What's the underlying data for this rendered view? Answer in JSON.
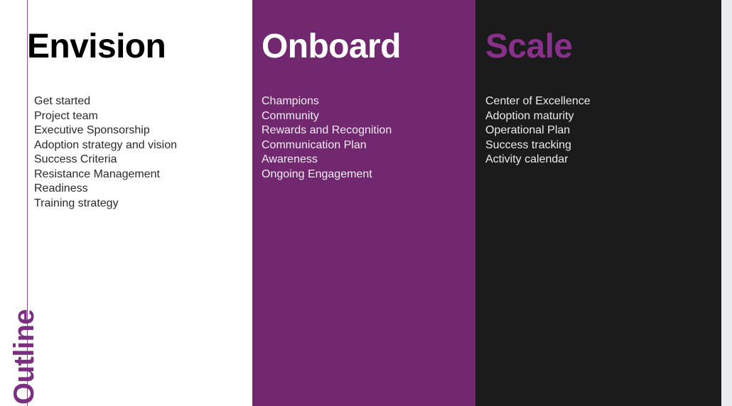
{
  "slide": {
    "section_label": "Outline",
    "accent_purple": "#7c2f80",
    "block_purple": "#71286f",
    "block_dark": "#1b1b1b"
  },
  "columns": [
    {
      "id": "envision",
      "title": "Envision",
      "items": [
        "Get started",
        "Project team",
        "Executive Sponsorship",
        "Adoption strategy and vision",
        "Success Criteria",
        "Resistance Management",
        "Readiness",
        "Training strategy"
      ]
    },
    {
      "id": "onboard",
      "title": "Onboard",
      "items": [
        "Champions",
        "Community",
        "Rewards and Recognition",
        "Communication Plan",
        "Awareness",
        "Ongoing Engagement"
      ]
    },
    {
      "id": "scale",
      "title": "Scale",
      "items": [
        "Center of Excellence",
        "Adoption maturity",
        "Operational Plan",
        "Success tracking",
        "Activity calendar"
      ]
    }
  ]
}
